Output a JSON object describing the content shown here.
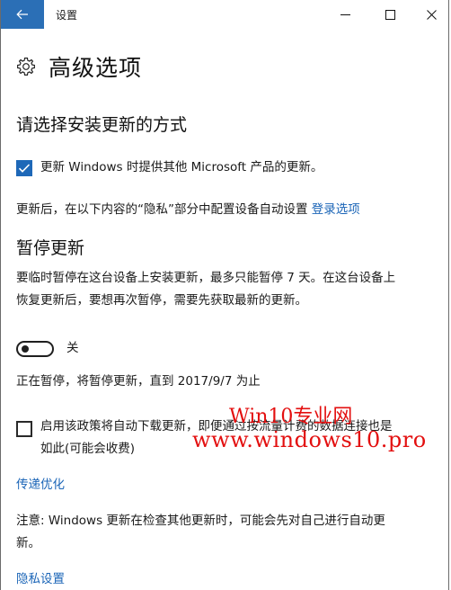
{
  "window": {
    "title": "设置",
    "accent_color": "#2b6fb6"
  },
  "icons": {
    "back": "arrow-left-icon",
    "minimize": "minimize-icon",
    "maximize": "maximize-icon",
    "close": "close-icon",
    "gear": "gear-icon",
    "checkmark": "checkmark-icon"
  },
  "page": {
    "title": "高级选项"
  },
  "install_section": {
    "heading": "请选择安装更新的方式",
    "other_products_checkbox": {
      "label": "更新 Windows 时提供其他 Microsoft 产品的更新。",
      "checked": true
    },
    "signin_text": "更新后，在以下内容的“隐私”部分中配置设备自动设置",
    "signin_link": "登录选项"
  },
  "pause_section": {
    "heading": "暂停更新",
    "description_line1": "要临时暂停在这台设备上安装更新，最多只能暂停 7 天。在这台设备上",
    "description_line2": "恢复更新后，要想再次暂停，需要先获取最新的更新。",
    "toggle_state_label": "关",
    "toggle_on": false,
    "status_text": "正在暂停，将暂停更新，直到 2017/9/7 为止"
  },
  "metered_checkbox": {
    "label_line1": "启用该政策将自动下载更新，即便通过按流量计费的数据连接也是",
    "label_line2": "如此(可能会收费)",
    "checked": false
  },
  "delivery_optimization_link": "传递优化",
  "note": {
    "line1": "注意: Windows 更新在检查其他更新时，可能会先对自己进行自动更",
    "line2": "新。"
  },
  "privacy_settings_link": "隐私设置",
  "watermark": {
    "line1": "Win10专业网",
    "line2": "www.windows10.pro",
    "color": "#e30f0f"
  }
}
